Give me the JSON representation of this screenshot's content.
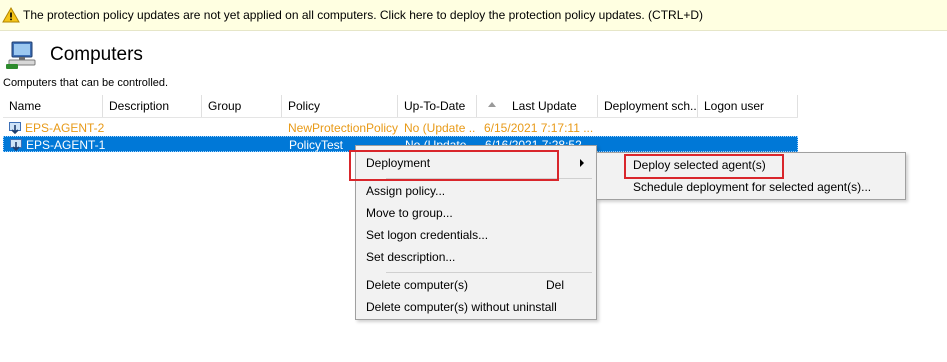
{
  "notification": {
    "text": "The protection policy updates are not yet applied on all computers. Click here to deploy the protection policy updates. (CTRL+D)",
    "icon": "warning-icon"
  },
  "header": {
    "title": "Computers",
    "subtitle": "Computers that can be controlled.",
    "icon": "computers-icon"
  },
  "table": {
    "columns": [
      "Name",
      "Description",
      "Group",
      "Policy",
      "Up-To-Date",
      "Last Update",
      "Deployment sch...",
      "Logon user"
    ],
    "sorted_column": "Last Update",
    "rows": [
      {
        "name": "EPS-AGENT-2",
        "description": "",
        "group": "",
        "policy": "NewProtectionPolicy",
        "up_to_date": "No (Update ...",
        "last_update": "6/15/2021 7:17:11 ...",
        "status_color": "#e89a18"
      },
      {
        "name": "EPS-AGENT-1",
        "description": "",
        "group": "",
        "policy": "PolicyTest",
        "up_to_date": "No (Update ...",
        "last_update": "6/16/2021 7:28:52 ...",
        "selected": true
      }
    ]
  },
  "context_menu": {
    "items": [
      {
        "label": "Deployment",
        "has_submenu": true
      },
      {
        "label": "Assign policy..."
      },
      {
        "label": "Move to group..."
      },
      {
        "label": "Set logon credentials..."
      },
      {
        "label": "Set description..."
      },
      {
        "label": "Delete computer(s)",
        "shortcut": "Del"
      },
      {
        "label": "Delete computer(s) without uninstall"
      }
    ]
  },
  "submenu": {
    "items": [
      {
        "label": "Deploy selected agent(s)"
      },
      {
        "label": "Schedule deployment for selected agent(s)..."
      }
    ]
  },
  "colors": {
    "selection": "#0078d7",
    "notification_bg": "#ffffe1",
    "highlight_box": "#d9262b",
    "pending_text": "#e89a18"
  }
}
